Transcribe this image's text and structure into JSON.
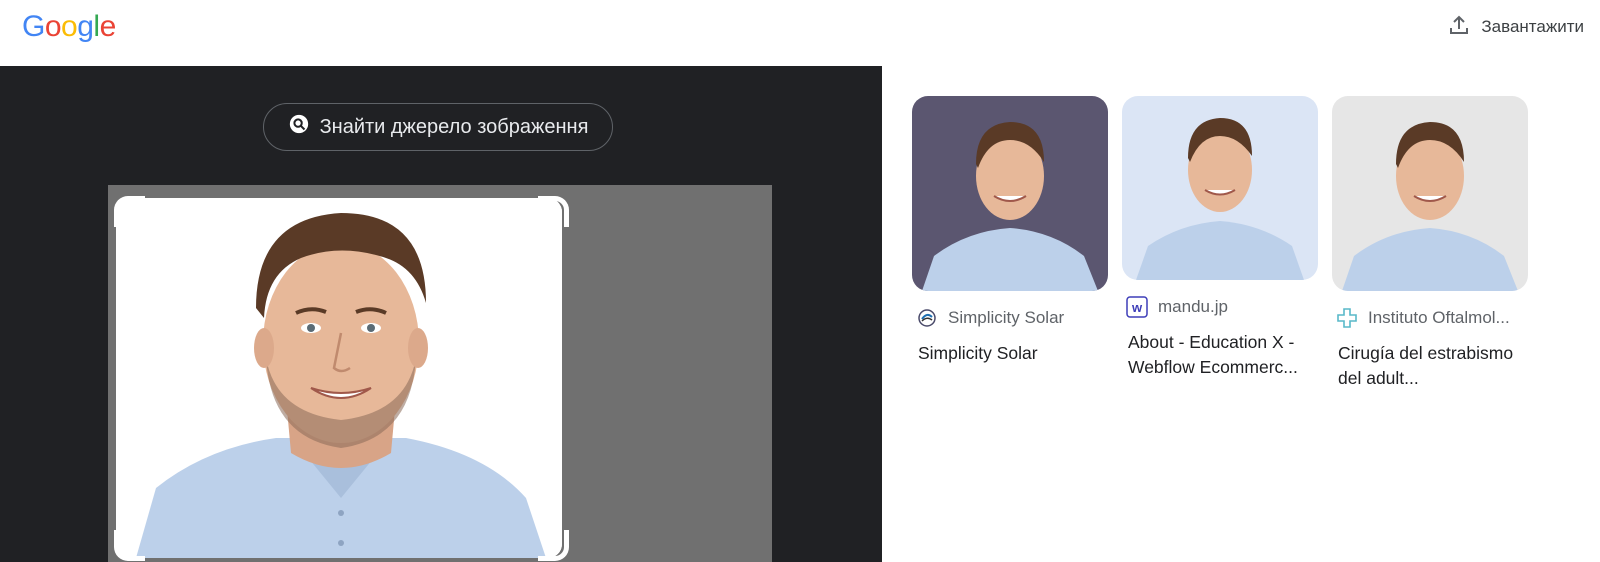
{
  "header": {
    "logo_letters": [
      {
        "char": "G",
        "color": "#4285F4"
      },
      {
        "char": "o",
        "color": "#EA4335"
      },
      {
        "char": "o",
        "color": "#FBBC05"
      },
      {
        "char": "g",
        "color": "#4285F4"
      },
      {
        "char": "l",
        "color": "#34A853"
      },
      {
        "char": "e",
        "color": "#EA4335"
      }
    ],
    "upload_label": "Завантажити",
    "upload_icon": "upload-icon"
  },
  "lens": {
    "find_source_label": "Знайти джерело зображення",
    "find_source_icon": "lens-search-icon"
  },
  "results": [
    {
      "source": "Simplicity Solar",
      "title": "Simplicity Solar",
      "favicon": "simplicity-solar-favicon",
      "bg": "#5b5670"
    },
    {
      "source": "mandu.jp",
      "title": "About - Education X - Webflow Ecommerc...",
      "favicon": "webflow-favicon",
      "bg": "#dbe5f5"
    },
    {
      "source": "Instituto Oftalmol...",
      "title": "Cirugía del estrabismo del adult...",
      "favicon": "instituto-favicon",
      "bg": "#e6e6e6"
    }
  ]
}
